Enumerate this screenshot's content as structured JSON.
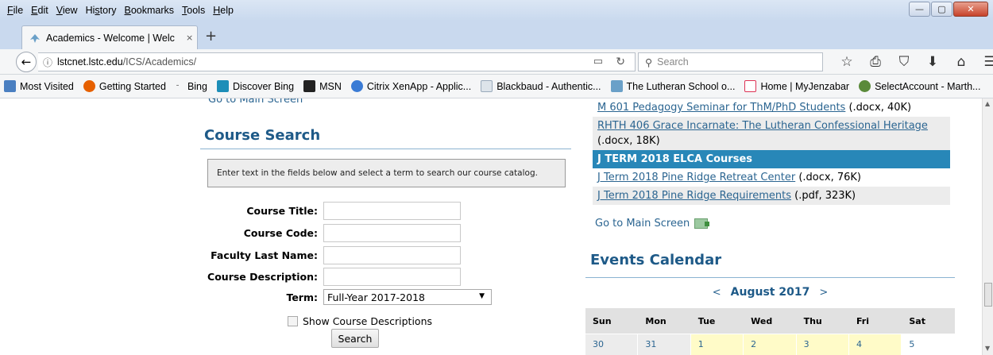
{
  "menu": {
    "items": [
      {
        "pre": "",
        "key": "F",
        "post": "ile"
      },
      {
        "pre": "",
        "key": "E",
        "post": "dit"
      },
      {
        "pre": "",
        "key": "V",
        "post": "iew"
      },
      {
        "pre": "Hi",
        "key": "s",
        "post": "tory"
      },
      {
        "pre": "",
        "key": "B",
        "post": "ookmarks"
      },
      {
        "pre": "",
        "key": "T",
        "post": "ools"
      },
      {
        "pre": "",
        "key": "H",
        "post": "elp"
      }
    ]
  },
  "window": {
    "minimize": "—",
    "restore": "▢",
    "close": "✕"
  },
  "tab": {
    "label": "Academics - Welcome | Welc",
    "close": "×",
    "new": "+"
  },
  "nav": {
    "back": "←",
    "info": "ⓘ",
    "url_host": "lstcnet.lstc.edu",
    "url_path": "/ICS/Academics/",
    "search_placeholder": "Search",
    "icons": [
      "☆",
      "⎙",
      "⛉",
      "⬇",
      "⌂",
      "☰"
    ]
  },
  "bookmarks": [
    {
      "label": "Most Visited",
      "color": "#4a7fc1"
    },
    {
      "label": "Getting Started",
      "color": "#e66000"
    },
    {
      "label": "Bing",
      "color": ""
    },
    {
      "label": "Discover Bing",
      "color": "#1d8eb8"
    },
    {
      "label": "MSN",
      "color": "#222222"
    },
    {
      "label": "Citrix XenApp - Applic...",
      "color": "#3a7bd5"
    },
    {
      "label": "Blackbaud - Authentic...",
      "color": "#9ab"
    },
    {
      "label": "The Lutheran School o...",
      "color": "#6aa0c8"
    },
    {
      "label": "Home | MyJenzabar",
      "color": "#d35"
    },
    {
      "label": "SelectAccount - Marth...",
      "color": "#5a8a3a"
    }
  ],
  "left": {
    "go_main_top": "Go to Main Screen",
    "course_search_title": "Course Search",
    "info_text": "Enter text in the fields below and select a term to search our course catalog.",
    "labels": {
      "course_title": "Course Title:",
      "course_code": "Course Code:",
      "faculty": "Faculty Last Name:",
      "description": "Course Description:",
      "term": "Term:"
    },
    "term_value": "Full-Year 2017-2018",
    "show_desc": "Show Course Descriptions",
    "search_button": "Search"
  },
  "right": {
    "files": [
      {
        "link": "M 601 Pedagogy Seminar for ThM/PhD Students",
        "meta": " (.docx, 40K)"
      },
      {
        "link": "RHTH 406 Grace Incarnate: The Lutheran Confessional Heritage",
        "meta": "(.docx, 18K)"
      }
    ],
    "term_heading": "J TERM 2018 ELCA Courses",
    "files2": [
      {
        "link": "J Term 2018 Pine Ridge Retreat Center",
        "meta": " (.docx, 76K)"
      },
      {
        "link": "J Term 2018 Pine Ridge Requirements",
        "meta": " (.pdf, 323K)"
      }
    ],
    "go_main": "Go to Main Screen",
    "events_title": "Events Calendar",
    "calendar": {
      "prev": "<",
      "month": "August 2017",
      "next": ">",
      "days": [
        "Sun",
        "Mon",
        "Tue",
        "Wed",
        "Thu",
        "Fri",
        "Sat"
      ],
      "week1": [
        "30",
        "31",
        "1",
        "2",
        "3",
        "4",
        "5"
      ]
    }
  }
}
